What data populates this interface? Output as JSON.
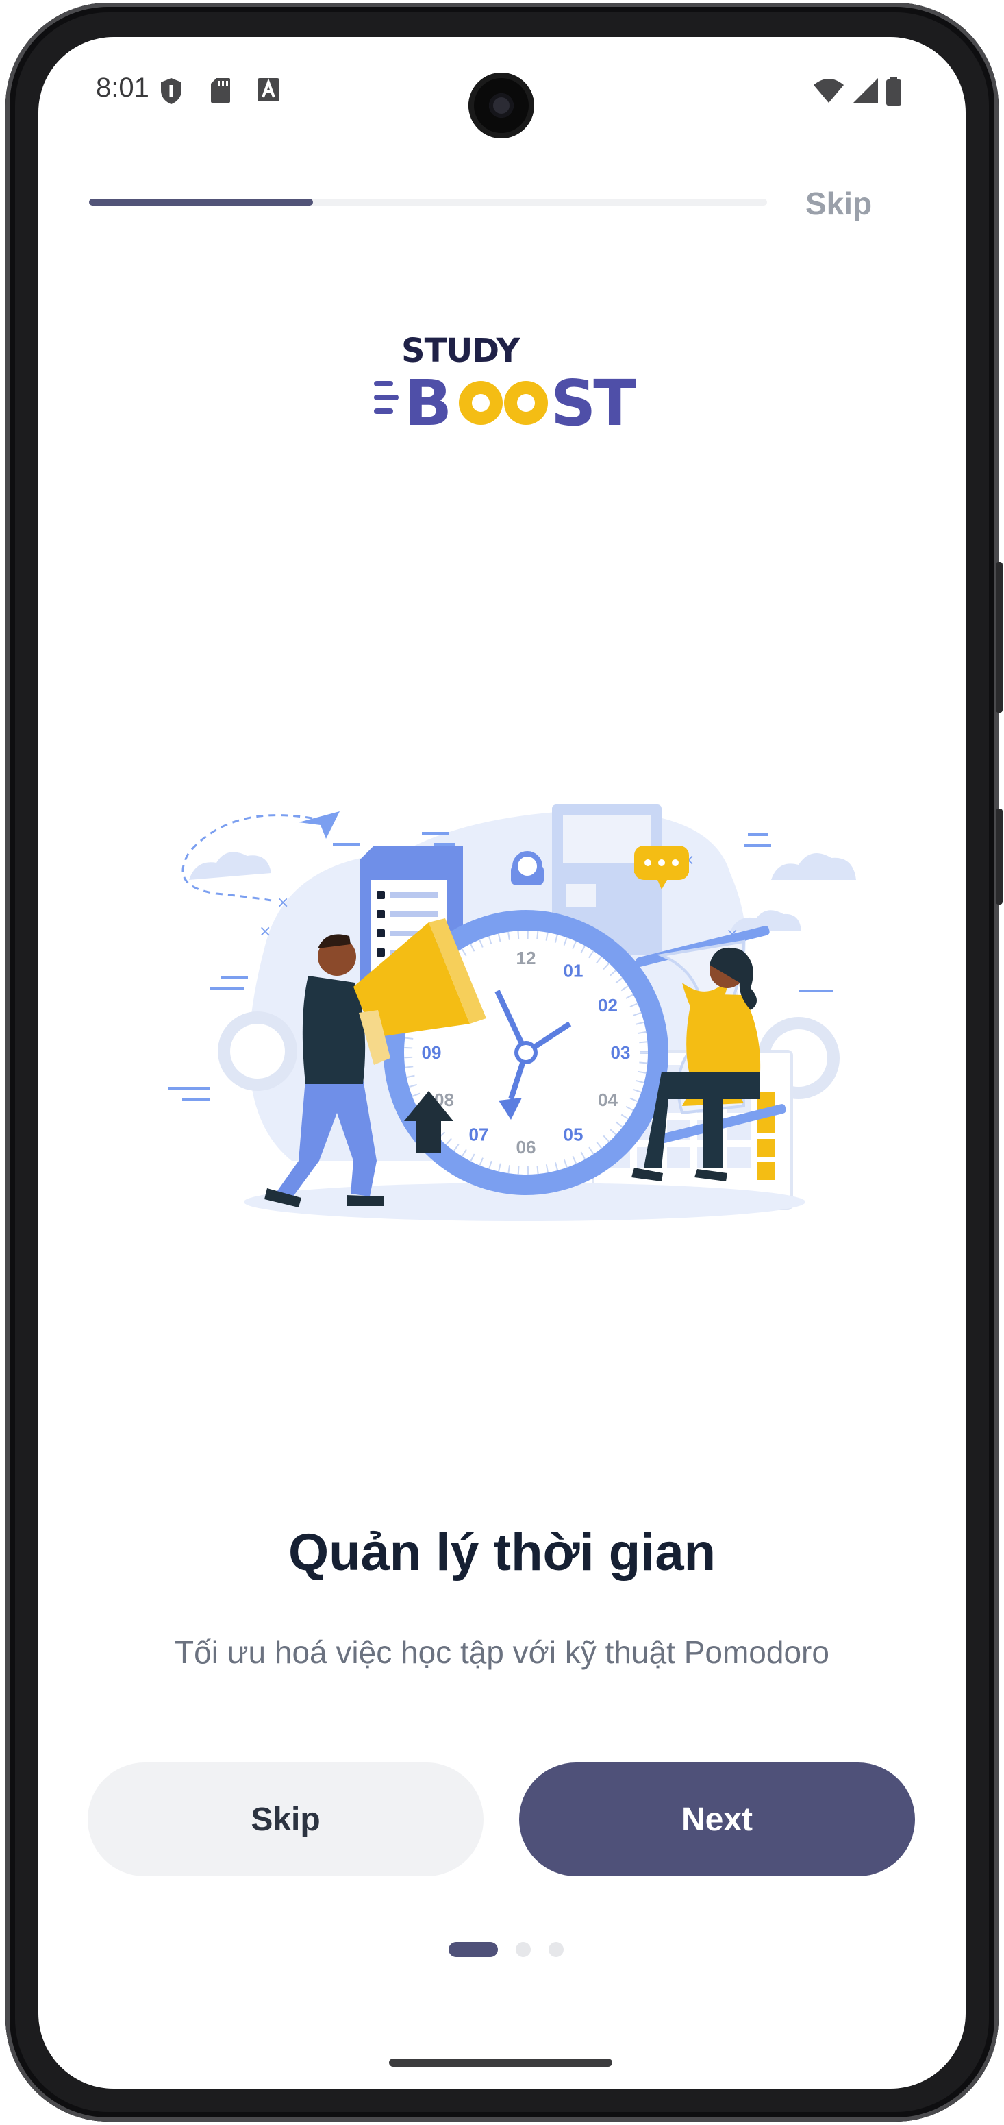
{
  "status_bar": {
    "time": "8:01",
    "left_icons": [
      "shield-icon",
      "sd-card-icon",
      "font-icon"
    ],
    "right_icons": [
      "wifi-icon",
      "signal-icon",
      "battery-icon"
    ]
  },
  "onboarding": {
    "progress": 0.33,
    "top_skip_label": "Skip",
    "logo": {
      "line1": "STUDY",
      "line2": "BOOST"
    },
    "illustration": {
      "clock_numbers": [
        "12",
        "01",
        "02",
        "03",
        "04",
        "05",
        "06",
        "07",
        "08",
        "09"
      ]
    },
    "title": "Quản lý thời gian",
    "subtitle": "Tối ưu hoá việc học tập với kỹ thuật Pomodoro",
    "skip_button_label": "Skip",
    "next_button_label": "Next",
    "page_indicator": {
      "count": 3,
      "active_index": 0
    }
  },
  "colors": {
    "primary": "#4f5179",
    "progress": "#525478",
    "logo_blue": "#4f4fa8",
    "logo_yellow": "#f4bd14",
    "title": "#162033",
    "subtitle": "#6b7280",
    "illustration_blue": "#7b9ff0",
    "illustration_yellow": "#f4bd14"
  }
}
